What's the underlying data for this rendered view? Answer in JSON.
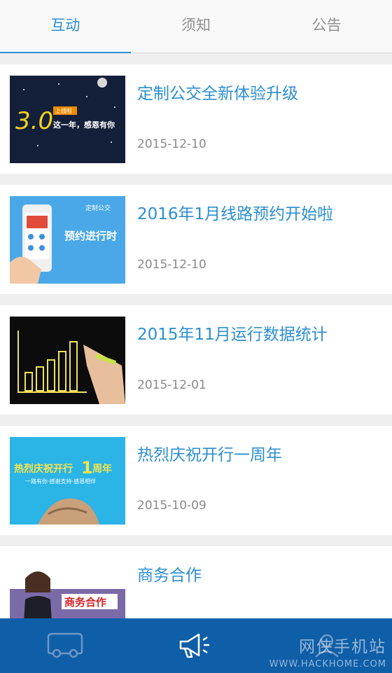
{
  "tabs": [
    {
      "label": "互动",
      "active": true
    },
    {
      "label": "须知",
      "active": false
    },
    {
      "label": "公告",
      "active": false
    }
  ],
  "news": [
    {
      "title": "定制公交全新体验升级",
      "date": "2015-12-10",
      "thumb_text_1": "3.0",
      "thumb_text_2": "上线啦",
      "thumb_text_3": "这一年，感恩有你"
    },
    {
      "title": "2016年1月线路预约开始啦",
      "date": "2015-12-10",
      "thumb_text_1": "定制公交",
      "thumb_text_2": "预约进行时"
    },
    {
      "title": "2015年11月运行数据统计",
      "date": "2015-12-01"
    },
    {
      "title": "热烈庆祝开行一周年",
      "date": "2015-10-09",
      "thumb_text_1": "热烈庆祝开行",
      "thumb_text_2": "1",
      "thumb_text_3": "周年",
      "thumb_text_4": "一路有你·感谢支持·感恩相伴"
    },
    {
      "title": "商务合作",
      "date": "",
      "thumb_text_1": "商务合作"
    }
  ],
  "bottom_nav": [
    {
      "icon": "bus-icon",
      "active": false
    },
    {
      "icon": "megaphone-icon",
      "active": true
    },
    {
      "icon": "user-icon",
      "active": false
    }
  ],
  "watermark": {
    "line1": "网侠手机站",
    "line2": "WWW.HACKHOME.COM"
  },
  "colors": {
    "accent": "#2b8fd0",
    "bottom_bar": "#0f5ea8",
    "background": "#efefef"
  }
}
